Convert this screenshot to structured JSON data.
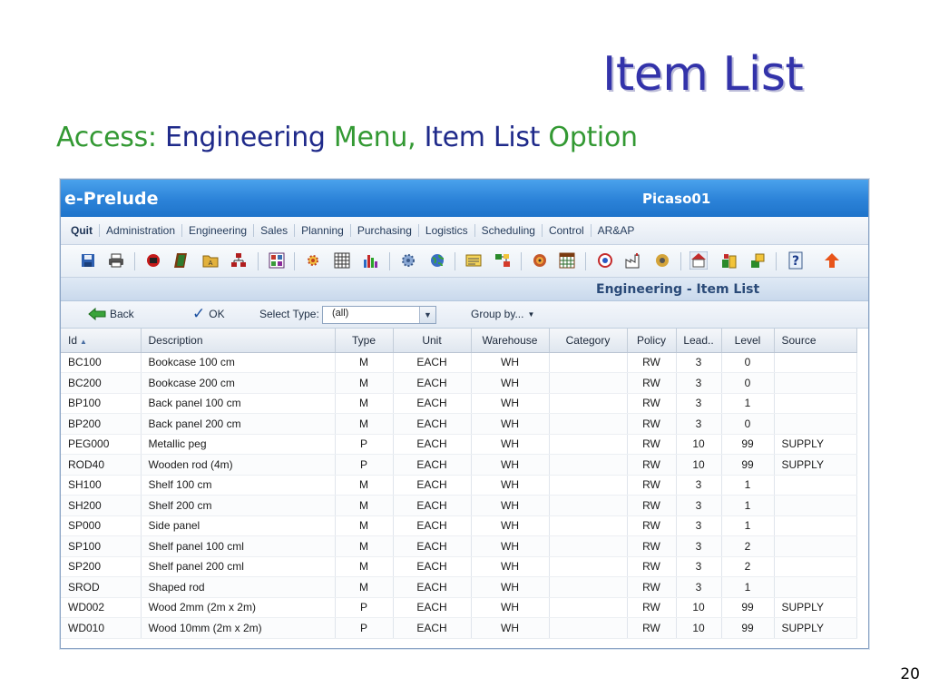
{
  "slide": {
    "title": "Item List",
    "subtitle": {
      "access": "Access:",
      "menu_name": "Engineering",
      "menu_word": "Menu,",
      "option_name": "Item List",
      "option_word": "Option"
    },
    "page_number": "20"
  },
  "app": {
    "name": "e-Prelude",
    "user": "Picaso01",
    "menu": [
      "Quit",
      "Administration",
      "Engineering",
      "Sales",
      "Planning",
      "Purchasing",
      "Logistics",
      "Scheduling",
      "Control",
      "AR&AP"
    ],
    "toolbar_icons": [
      "save-icon",
      "print-icon",
      "import-icon",
      "document-icon",
      "folder-icon",
      "hierarchy-icon",
      "matrix-icon",
      "gear-icon",
      "grid-icon",
      "bar-chart-icon",
      "settings-icon",
      "globe-icon",
      "note-icon",
      "workflow-icon",
      "disc-icon",
      "calendar-icon",
      "target-icon",
      "factory-icon",
      "cd-icon",
      "home-icon",
      "blocks-icon",
      "stack-icon",
      "help-icon",
      "upload-icon"
    ],
    "section_title": "Engineering - Item List",
    "actions": {
      "back": "Back",
      "ok": "OK",
      "select_type_label": "Select Type:",
      "select_type_value": "(all)",
      "group_by": "Group by..."
    },
    "table": {
      "columns": [
        "Id",
        "Description",
        "Type",
        "Unit",
        "Warehouse",
        "Category",
        "Policy",
        "Lead..",
        "Level",
        "Source"
      ],
      "rows": [
        [
          "BC100",
          "Bookcase 100 cm",
          "M",
          "EACH",
          "WH",
          "",
          "RW",
          "3",
          "0",
          ""
        ],
        [
          "BC200",
          "Bookcase 200 cm",
          "M",
          "EACH",
          "WH",
          "",
          "RW",
          "3",
          "0",
          ""
        ],
        [
          "BP100",
          "Back panel 100 cm",
          "M",
          "EACH",
          "WH",
          "",
          "RW",
          "3",
          "1",
          ""
        ],
        [
          "BP200",
          "Back panel 200 cm",
          "M",
          "EACH",
          "WH",
          "",
          "RW",
          "3",
          "0",
          ""
        ],
        [
          "PEG000",
          "Metallic peg",
          "P",
          "EACH",
          "WH",
          "",
          "RW",
          "10",
          "99",
          "SUPPLY"
        ],
        [
          "ROD40",
          "Wooden rod (4m)",
          "P",
          "EACH",
          "WH",
          "",
          "RW",
          "10",
          "99",
          "SUPPLY"
        ],
        [
          "SH100",
          "Shelf 100 cm",
          "M",
          "EACH",
          "WH",
          "",
          "RW",
          "3",
          "1",
          ""
        ],
        [
          "SH200",
          "Shelf 200 cm",
          "M",
          "EACH",
          "WH",
          "",
          "RW",
          "3",
          "1",
          ""
        ],
        [
          "SP000",
          "Side panel",
          "M",
          "EACH",
          "WH",
          "",
          "RW",
          "3",
          "1",
          ""
        ],
        [
          "SP100",
          "Shelf panel 100 cml",
          "M",
          "EACH",
          "WH",
          "",
          "RW",
          "3",
          "2",
          ""
        ],
        [
          "SP200",
          "Shelf panel 200 cml",
          "M",
          "EACH",
          "WH",
          "",
          "RW",
          "3",
          "2",
          ""
        ],
        [
          "SROD",
          "Shaped rod",
          "M",
          "EACH",
          "WH",
          "",
          "RW",
          "3",
          "1",
          ""
        ],
        [
          "WD002",
          "Wood 2mm (2m x 2m)",
          "P",
          "EACH",
          "WH",
          "",
          "RW",
          "10",
          "99",
          "SUPPLY"
        ],
        [
          "WD010",
          "Wood 10mm (2m x 2m)",
          "P",
          "EACH",
          "WH",
          "",
          "RW",
          "10",
          "99",
          "SUPPLY"
        ]
      ]
    }
  },
  "colors": {
    "title": "#3333aa",
    "subtitle_green": "#339933",
    "subtitle_blue": "#1f2a8a",
    "titlebar": "#2b82d8"
  }
}
